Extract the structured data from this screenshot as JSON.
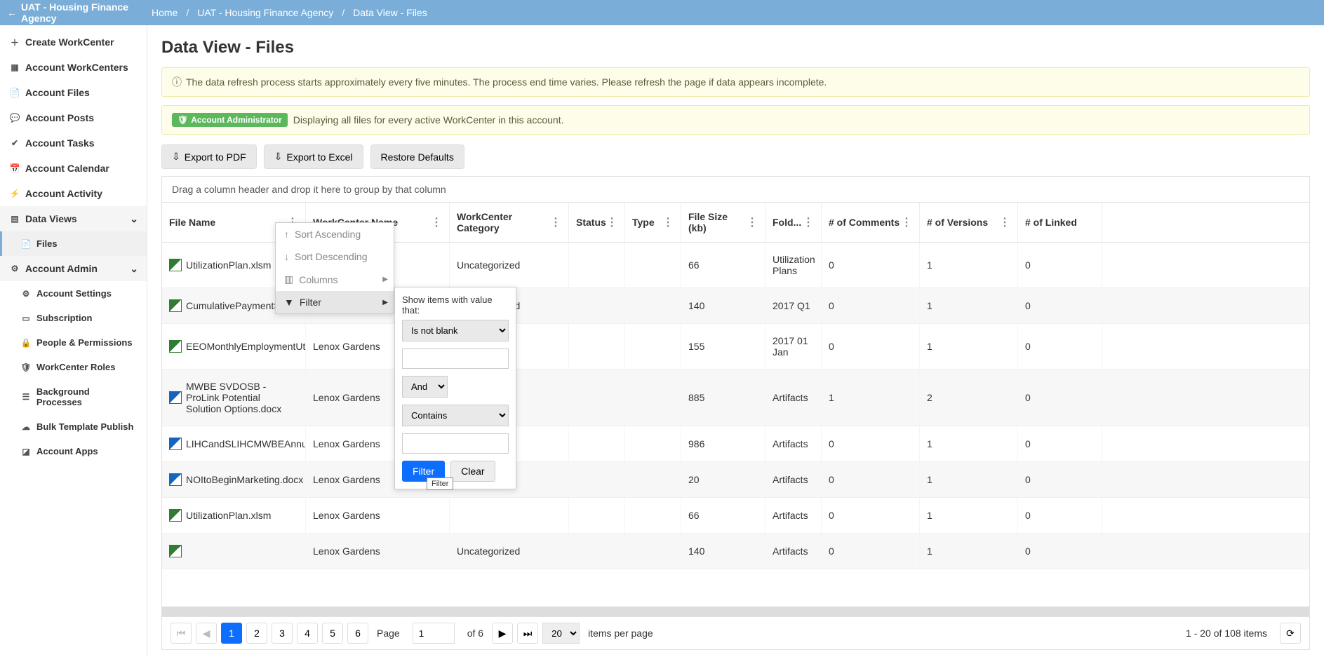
{
  "topbar": {
    "back_label": "UAT - Housing Finance Agency",
    "crumbs": [
      "Home",
      "UAT - Housing Finance Agency",
      "Data View - Files"
    ]
  },
  "sidebar": {
    "create": "Create WorkCenter",
    "workcenters": "Account WorkCenters",
    "files": "Account Files",
    "posts": "Account Posts",
    "tasks": "Account Tasks",
    "calendar": "Account Calendar",
    "activity": "Account Activity",
    "dataviews": "Data Views",
    "dv_files": "Files",
    "admin": "Account Admin",
    "settings": "Account Settings",
    "subscription": "Subscription",
    "people": "People & Permissions",
    "roles": "WorkCenter Roles",
    "bg": "Background Processes",
    "bulk": "Bulk Template Publish",
    "apps": "Account Apps"
  },
  "page": {
    "title": "Data View - Files",
    "info": "The data refresh process starts approximately every five minutes. The process end time varies. Please refresh the page if data appears incomplete.",
    "badge": "Account Administrator",
    "admin_msg": "Displaying all files for every active WorkCenter in this account.",
    "export_pdf": "Export to PDF",
    "export_excel": "Export to Excel",
    "restore": "Restore Defaults",
    "group_hint": "Drag a column header and drop it here to group by that column"
  },
  "columns": {
    "file": "File Name",
    "wc": "WorkCenter Name",
    "cat": "WorkCenter Category",
    "status": "Status",
    "type": "Type",
    "size": "File Size (kb)",
    "folder": "Fold...",
    "comments": "# of Comments",
    "versions": "# of Versions",
    "linked": "# of Linked"
  },
  "context_menu": {
    "asc": "Sort Ascending",
    "desc": "Sort Descending",
    "cols": "Columns",
    "filter": "Filter"
  },
  "filter": {
    "header": "Show items with value that:",
    "op1": "Is not blank",
    "logic": "And",
    "op2": "Contains",
    "btn_filter": "Filter",
    "btn_clear": "Clear",
    "tooltip": "Filter"
  },
  "rows": [
    {
      "file": "UtilizationPlan.xlsm",
      "ftype": "xls",
      "wc": "",
      "cat": "Uncategorized",
      "size": "66",
      "folder": "Utilization Plans",
      "comments": "0",
      "versions": "1",
      "linked": "0"
    },
    {
      "file": "CumulativePaymentStateme...",
      "ftype": "xls",
      "wc": "",
      "cat": "Uncategorized",
      "size": "140",
      "folder": "2017 Q1",
      "comments": "0",
      "versions": "1",
      "linked": "0"
    },
    {
      "file": "EEOMonthlyEmploymentUtiliza...",
      "ftype": "xls",
      "wc": "Lenox Gardens",
      "cat": "",
      "size": "155",
      "folder": "2017 01 Jan",
      "comments": "0",
      "versions": "1",
      "linked": "0"
    },
    {
      "file": "MWBE SVDOSB - ProLink Potential Solution Options.docx",
      "ftype": "doc",
      "wc": "Lenox Gardens",
      "cat": "",
      "size": "885",
      "folder": "Artifacts",
      "comments": "1",
      "versions": "2",
      "linked": "0"
    },
    {
      "file": "LIHCandSLIHCMWBEAnnualRe...",
      "ftype": "doc",
      "wc": "Lenox Gardens",
      "cat": "",
      "size": "986",
      "folder": "Artifacts",
      "comments": "0",
      "versions": "1",
      "linked": "0"
    },
    {
      "file": "NOItoBeginMarketing.docx",
      "ftype": "doc",
      "wc": "Lenox Gardens",
      "cat": "",
      "size": "20",
      "folder": "Artifacts",
      "comments": "0",
      "versions": "1",
      "linked": "0"
    },
    {
      "file": "UtilizationPlan.xlsm",
      "ftype": "xls",
      "wc": "Lenox Gardens",
      "cat": "",
      "size": "66",
      "folder": "Artifacts",
      "comments": "0",
      "versions": "1",
      "linked": "0"
    },
    {
      "file": "",
      "ftype": "xls",
      "wc": "Lenox Gardens",
      "cat": "Uncategorized",
      "size": "140",
      "folder": "Artifacts",
      "comments": "0",
      "versions": "1",
      "linked": "0"
    }
  ],
  "pager": {
    "page_label": "Page",
    "of_label": "of 6",
    "current": "1",
    "pages": [
      "1",
      "2",
      "3",
      "4",
      "5",
      "6"
    ],
    "per_page": "20",
    "per_label": "items per page",
    "summary": "1 - 20 of 108 items"
  }
}
